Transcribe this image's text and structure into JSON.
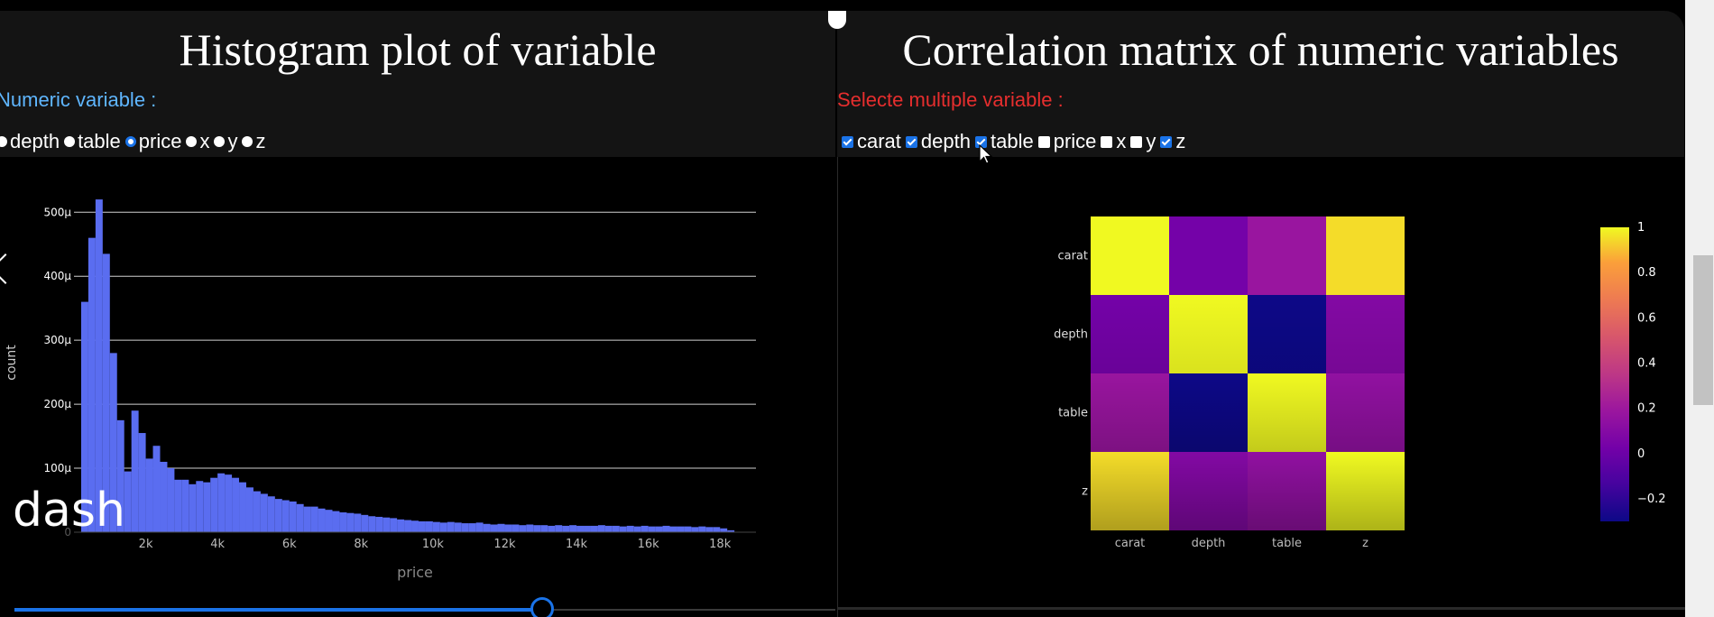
{
  "left": {
    "title": "Histogram plot of variable",
    "label": "Numeric variable :",
    "label_color": "#5fb6ff",
    "options": [
      {
        "label": "depth",
        "selected": false
      },
      {
        "label": "table",
        "selected": false
      },
      {
        "label": "price",
        "selected": true
      },
      {
        "label": "x",
        "selected": false
      },
      {
        "label": "y",
        "selected": false
      },
      {
        "label": "z",
        "selected": false
      }
    ]
  },
  "right": {
    "title": "Correlation matrix of numeric variables",
    "label": "Selecte multiple variable :",
    "label_color": "#e62e2e",
    "options": [
      {
        "label": "carat",
        "checked": true
      },
      {
        "label": "depth",
        "checked": true
      },
      {
        "label": "table",
        "checked": true
      },
      {
        "label": "price",
        "checked": false
      },
      {
        "label": "x",
        "checked": false
      },
      {
        "label": "y",
        "checked": false
      },
      {
        "label": "z",
        "checked": true
      }
    ]
  },
  "overlay_text": "dash",
  "accent_color": "#1a73e8",
  "chart_data": [
    {
      "type": "bar",
      "xlabel": "price",
      "ylabel": "count",
      "xlim": [
        0,
        19000
      ],
      "ylim": [
        0,
        0.00053
      ],
      "x_ticks": [
        2000,
        4000,
        6000,
        8000,
        10000,
        12000,
        14000,
        16000,
        18000
      ],
      "x_tick_labels": [
        "2k",
        "4k",
        "6k",
        "8k",
        "10k",
        "12k",
        "14k",
        "16k",
        "18k"
      ],
      "y_ticks": [
        0,
        0.0001,
        0.0002,
        0.0003,
        0.0004,
        0.0005
      ],
      "y_tick_labels": [
        "0",
        "100μ",
        "200μ",
        "300μ",
        "400μ",
        "500μ"
      ],
      "bin_start": 200,
      "bin_width": 200,
      "values": [
        0.00036,
        0.00046,
        0.00052,
        0.000435,
        0.00028,
        0.000175,
        9.5e-05,
        0.00019,
        0.000155,
        0.000115,
        0.000135,
        0.00011,
        0.0001,
        8.2e-05,
        8.2e-05,
        7.5e-05,
        8e-05,
        7.8e-05,
        8.5e-05,
        9.2e-05,
        9e-05,
        8.5e-05,
        7.8e-05,
        7e-05,
        6.4e-05,
        6e-05,
        5.6e-05,
        5.2e-05,
        5e-05,
        4.8e-05,
        4.4e-05,
        4e-05,
        4e-05,
        3.7e-05,
        3.5e-05,
        3.3e-05,
        3.1e-05,
        3e-05,
        2.9e-05,
        2.7e-05,
        2.5e-05,
        2.4e-05,
        2.3e-05,
        2.2e-05,
        2e-05,
        1.9e-05,
        1.8e-05,
        1.7e-05,
        1.7e-05,
        1.6e-05,
        1.5e-05,
        1.6e-05,
        1.5e-05,
        1.4e-05,
        1.4e-05,
        1.5e-05,
        1.3e-05,
        1.2e-05,
        1.3e-05,
        1.2e-05,
        1.2e-05,
        1.1e-05,
        1.2e-05,
        1.1e-05,
        1.1e-05,
        1e-05,
        1.1e-05,
        1e-05,
        1.1e-05,
        1e-05,
        1e-05,
        1e-05,
        1.1e-05,
        1e-05,
        1e-05,
        9e-06,
        1e-05,
        9e-06,
        1e-05,
        9e-06,
        9e-06,
        1e-05,
        9e-06,
        9e-06,
        9e-06,
        8e-06,
        9e-06,
        8e-06,
        8e-06,
        6e-06,
        3e-06
      ],
      "bar_color": "#5a6df0",
      "grid": true
    },
    {
      "type": "heatmap",
      "x_categories": [
        "carat",
        "depth",
        "table",
        "z"
      ],
      "y_categories": [
        "carat",
        "depth",
        "table",
        "z"
      ],
      "values": [
        [
          1.0,
          0.03,
          0.18,
          0.95
        ],
        [
          0.03,
          1.0,
          -0.3,
          0.09
        ],
        [
          0.18,
          -0.3,
          1.0,
          0.15
        ],
        [
          0.95,
          0.09,
          0.15,
          1.0
        ]
      ],
      "colorscale": "plasma",
      "zlim": [
        -0.3,
        1.0
      ],
      "colorbar_ticks": [
        1,
        0.8,
        0.6,
        0.4,
        0.2,
        0,
        -0.2
      ],
      "colorbar_tick_labels": [
        "1",
        "0.8",
        "0.6",
        "0.4",
        "0.2",
        "0",
        "−0.2"
      ]
    }
  ]
}
